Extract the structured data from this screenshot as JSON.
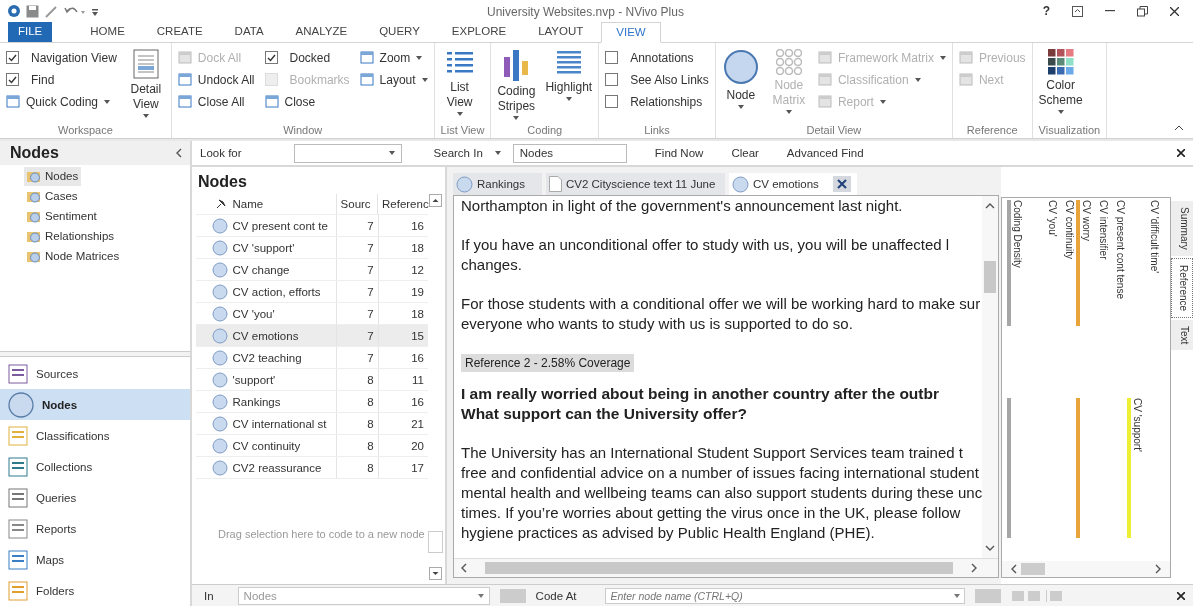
{
  "window": {
    "title": "University Websites.nvp - NVivo Plus",
    "help": "?"
  },
  "ribbon_tabs": [
    {
      "label": "FILE",
      "kind": "file",
      "selected": false
    },
    {
      "label": "HOME",
      "kind": "tab",
      "selected": false
    },
    {
      "label": "CREATE",
      "kind": "tab",
      "selected": false
    },
    {
      "label": "DATA",
      "kind": "tab",
      "selected": false
    },
    {
      "label": "ANALYZE",
      "kind": "tab",
      "selected": false
    },
    {
      "label": "QUERY",
      "kind": "tab",
      "selected": false
    },
    {
      "label": "EXPLORE",
      "kind": "tab",
      "selected": false
    },
    {
      "label": "LAYOUT",
      "kind": "tab",
      "selected": false
    },
    {
      "label": "VIEW",
      "kind": "tab",
      "selected": true
    }
  ],
  "ribbon": {
    "groups": [
      {
        "label": "Workspace",
        "columns": [
          {
            "kind": "stack",
            "items": [
              {
                "kind": "check",
                "label": "Navigation View",
                "checked": true,
                "disabled": false
              },
              {
                "kind": "check",
                "label": "Find",
                "checked": true,
                "disabled": false
              },
              {
                "kind": "command",
                "label": "Quick Coding",
                "dropdown": true,
                "disabled": false
              }
            ]
          },
          {
            "kind": "big",
            "lines": [
              "Detail",
              "View"
            ],
            "dropdown": true,
            "disabled": false
          }
        ]
      },
      {
        "label": "Window",
        "columns": [
          {
            "kind": "stack",
            "items": [
              {
                "kind": "command",
                "label": "Dock All",
                "dropdown": false,
                "disabled": true
              },
              {
                "kind": "command",
                "label": "Undock All",
                "dropdown": false,
                "disabled": false
              },
              {
                "kind": "command",
                "label": "Close All",
                "dropdown": false,
                "disabled": false
              }
            ]
          },
          {
            "kind": "stack",
            "items": [
              {
                "kind": "check",
                "label": "Docked",
                "checked": true,
                "disabled": false
              },
              {
                "kind": "check",
                "label": "Bookmarks",
                "checked": false,
                "disabled": true
              },
              {
                "kind": "command",
                "label": "Close",
                "dropdown": false,
                "disabled": false
              }
            ]
          },
          {
            "kind": "stack",
            "items": [
              {
                "kind": "command",
                "label": "Zoom",
                "dropdown": true,
                "disabled": false
              },
              {
                "kind": "command",
                "label": "Layout",
                "dropdown": true,
                "disabled": false
              }
            ]
          }
        ]
      },
      {
        "label": "List View",
        "columns": [
          {
            "kind": "big",
            "lines": [
              "List",
              "View"
            ],
            "dropdown": true,
            "disabled": false
          }
        ]
      },
      {
        "label": "Coding",
        "columns": [
          {
            "kind": "big",
            "lines": [
              "Coding",
              "Stripes"
            ],
            "dropdown": true,
            "disabled": false
          },
          {
            "kind": "big",
            "lines": [
              "Highlight"
            ],
            "dropdown": true,
            "disabled": false
          }
        ]
      },
      {
        "label": "Links",
        "columns": [
          {
            "kind": "stack",
            "items": [
              {
                "kind": "check",
                "label": "Annotations",
                "checked": false,
                "disabled": false
              },
              {
                "kind": "check",
                "label": "See Also Links",
                "checked": false,
                "disabled": false
              },
              {
                "kind": "check",
                "label": "Relationships",
                "checked": false,
                "disabled": false
              }
            ]
          }
        ]
      },
      {
        "label": "Detail View",
        "columns": [
          {
            "kind": "big",
            "lines": [
              "Node"
            ],
            "dropdown": true,
            "disabled": false
          },
          {
            "kind": "big",
            "lines": [
              "Node",
              "Matrix"
            ],
            "dropdown": true,
            "disabled": true
          },
          {
            "kind": "stack",
            "items": [
              {
                "kind": "command",
                "label": "Framework Matrix",
                "dropdown": true,
                "disabled": true
              },
              {
                "kind": "command",
                "label": "Classification",
                "dropdown": true,
                "disabled": true
              },
              {
                "kind": "command",
                "label": "Report",
                "dropdown": true,
                "disabled": true
              }
            ]
          }
        ]
      },
      {
        "label": "Reference",
        "columns": [
          {
            "kind": "stack",
            "items": [
              {
                "kind": "command",
                "label": "Previous",
                "dropdown": false,
                "disabled": true
              },
              {
                "kind": "command",
                "label": "Next",
                "dropdown": false,
                "disabled": true
              }
            ]
          }
        ]
      },
      {
        "label": "Visualization",
        "columns": [
          {
            "kind": "big",
            "lines": [
              "Color",
              "Scheme"
            ],
            "dropdown": true,
            "disabled": false
          }
        ]
      }
    ]
  },
  "navigation": {
    "title": "Nodes",
    "tree": [
      {
        "label": "Nodes",
        "selected": true
      },
      {
        "label": "Cases",
        "selected": false
      },
      {
        "label": "Sentiment",
        "selected": false
      },
      {
        "label": "Relationships",
        "selected": false
      },
      {
        "label": "Node Matrices",
        "selected": false
      }
    ],
    "buttons": [
      {
        "label": "Sources",
        "selected": false
      },
      {
        "label": "Nodes",
        "selected": true
      },
      {
        "label": "Classifications",
        "selected": false
      },
      {
        "label": "Collections",
        "selected": false
      },
      {
        "label": "Queries",
        "selected": false
      },
      {
        "label": "Reports",
        "selected": false
      },
      {
        "label": "Maps",
        "selected": false
      },
      {
        "label": "Folders",
        "selected": false
      }
    ]
  },
  "find_bar": {
    "look_for_label": "Look for",
    "search_in_label": "Search In",
    "search_in_value": "Nodes",
    "find_now": "Find Now",
    "clear": "Clear",
    "advanced_find": "Advanced Find"
  },
  "node_list": {
    "title": "Nodes",
    "columns": [
      "Name",
      "Sourc",
      "Referenc"
    ],
    "rows": [
      {
        "name": "CV present cont te",
        "sources": "7",
        "references": "16",
        "selected": false
      },
      {
        "name": "CV 'support'",
        "sources": "7",
        "references": "18",
        "selected": false
      },
      {
        "name": "CV change",
        "sources": "7",
        "references": "12",
        "selected": false
      },
      {
        "name": "CV action, efforts",
        "sources": "7",
        "references": "19",
        "selected": false
      },
      {
        "name": "CV 'you'",
        "sources": "7",
        "references": "18",
        "selected": false
      },
      {
        "name": "CV emotions",
        "sources": "7",
        "references": "15",
        "selected": true
      },
      {
        "name": "CV2 teaching",
        "sources": "7",
        "references": "16",
        "selected": false
      },
      {
        "name": "'support'",
        "sources": "8",
        "references": "11",
        "selected": false
      },
      {
        "name": "Rankings",
        "sources": "8",
        "references": "16",
        "selected": false
      },
      {
        "name": "CV international st",
        "sources": "8",
        "references": "21",
        "selected": false
      },
      {
        "name": "CV continuity",
        "sources": "8",
        "references": "20",
        "selected": false
      },
      {
        "name": "CV2 reassurance",
        "sources": "8",
        "references": "17",
        "selected": false
      }
    ],
    "drop_hint": "Drag selection here to code to a new node"
  },
  "detail_tabs": [
    {
      "label": "Rankings",
      "kind": "node",
      "selected": false
    },
    {
      "label": "CV2 Cityscience text 11 June",
      "kind": "document",
      "selected": false
    },
    {
      "label": "CV emotions",
      "kind": "node",
      "selected": true
    }
  ],
  "detail": {
    "blocks": [
      {
        "kind": "paragraph",
        "lines": [
          "Northampton in light of the government's announcement last night."
        ]
      },
      {
        "kind": "paragraph",
        "lines": [
          "If you have an unconditional offer to study with us, you will be unaffected l",
          "changes."
        ]
      },
      {
        "kind": "paragraph",
        "lines": [
          "For those students with a conditional offer we will be working hard to make sur",
          "everyone who wants to study with us is supported to do so."
        ]
      },
      {
        "kind": "reference",
        "lines": [
          "Reference 2 - 2.58% Coverage"
        ]
      },
      {
        "kind": "heading",
        "lines": [
          "I am really worried about being in another country after the outbr",
          "What support can the University offer?"
        ]
      },
      {
        "kind": "paragraph",
        "lines": [
          "The University has an International Student Support Services team trained t",
          "free and confidential advice on a number of issues facing international student",
          "mental health and wellbeing teams can also support students during these unc",
          "times. If you’re worries about getting the virus once in the UK, please follow",
          "hygiene practices as advised by Public Health England (PHE)."
        ]
      }
    ]
  },
  "coding_stripes": [
    {
      "label": "Coding Density",
      "kind": "upper",
      "color": "#a6a6a6",
      "segments": [
        {
          "kind": "upper"
        },
        {
          "kind": "lower"
        }
      ]
    },
    {
      "label": "CV 'you'",
      "kind": "upper"
    },
    {
      "label": "CV continuity",
      "kind": "upper"
    },
    {
      "label": "CV worry",
      "kind": "upper",
      "color": "#e8a33a",
      "segments": [
        {
          "kind": "upper"
        },
        {
          "kind": "lower"
        }
      ]
    },
    {
      "label": "CV intensifier",
      "kind": "upper"
    },
    {
      "label": "CV present cont tense",
      "kind": "upper"
    },
    {
      "label": "CV 'support'",
      "kind": "lower",
      "color": "#eeee33",
      "segments": [
        {
          "kind": "lower"
        }
      ]
    },
    {
      "label": "CV 'difficult time'",
      "kind": "upper"
    }
  ],
  "side_tabs": [
    {
      "label": "Summary",
      "selected": false
    },
    {
      "label": "Reference",
      "selected": true
    },
    {
      "label": "Text",
      "selected": false
    }
  ],
  "code_bar": {
    "in_label": "In",
    "in_value": "Nodes",
    "code_at_label": "Code At",
    "code_at_placeholder": "Enter node name (CTRL+Q)"
  }
}
